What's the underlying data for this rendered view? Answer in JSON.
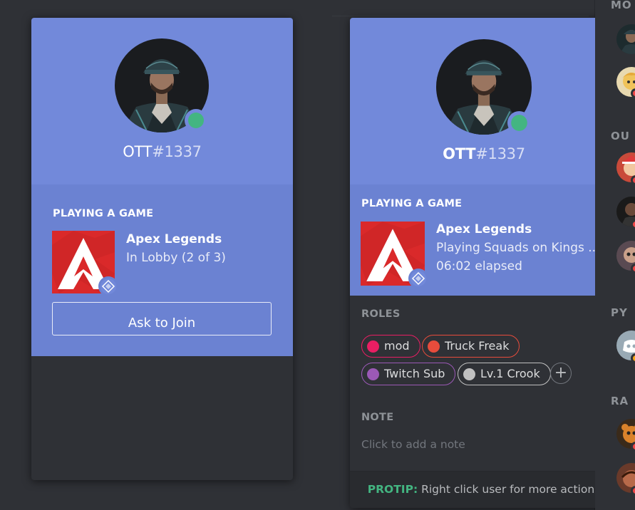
{
  "user": {
    "name": "OTT",
    "discriminator": "#1337",
    "status": "online",
    "status_color": "#43b581"
  },
  "card1": {
    "activity_label": "PLAYING A GAME",
    "game_name": "Apex Legends",
    "game_state": "In Lobby (2 of 3)",
    "join_button": "Ask to Join"
  },
  "card2": {
    "activity_label": "PLAYING A GAME",
    "game_name": "Apex Legends",
    "game_details": "Playing Squads on Kings ...",
    "elapsed": "06:02 elapsed",
    "roles_label": "ROLES",
    "roles": [
      {
        "name": "mod",
        "color": "#e91e63"
      },
      {
        "name": "Truck Freak",
        "color": "#e74c3c"
      },
      {
        "name": "Twitch Sub",
        "color": "#9b59b6"
      },
      {
        "name": "Lv.1 Crook",
        "color": "#c0c0c0"
      }
    ],
    "add_role_symbol": "+",
    "note_label": "NOTE",
    "note_placeholder": "Click to add a note",
    "protip_label": "PROTIP:",
    "protip_text": "Right click user for more actions"
  },
  "member_list": {
    "headers": [
      "MO",
      "OU",
      "PY",
      "RA"
    ]
  },
  "colors": {
    "blurple": "#7289da",
    "activity_bg": "#6b82d2",
    "card_bg": "#2f3136",
    "apex_red": "#da292a",
    "protip_green": "#43b581"
  },
  "icons": [
    "game-badge-icon",
    "add-role-icon",
    "status-online-icon"
  ]
}
